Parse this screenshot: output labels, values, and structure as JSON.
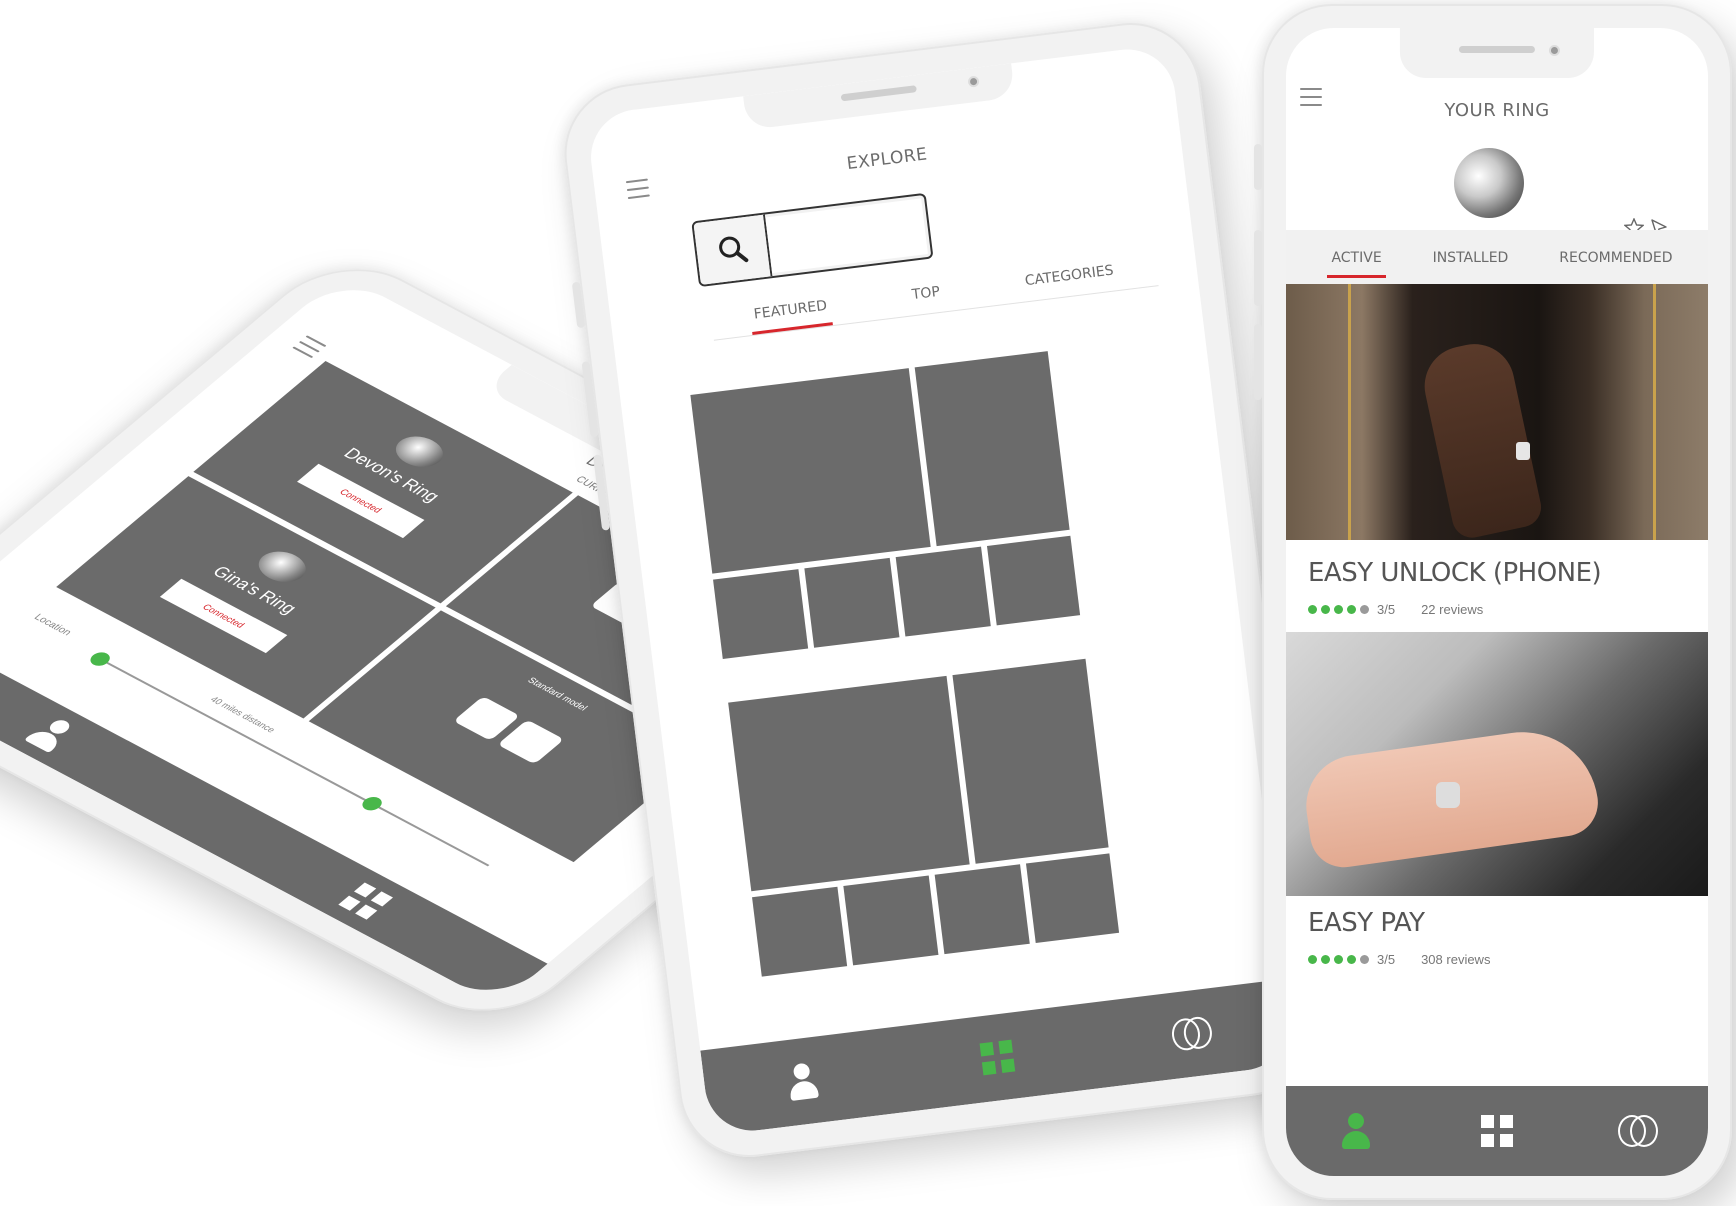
{
  "colors": {
    "accent_red": "#d7262c",
    "active_green": "#48b74a",
    "placeholder_gray": "#6b6b6b",
    "nav_gray": "#6a6a6a"
  },
  "devices_screen": {
    "title": "DEVICES",
    "section": "CURRENT",
    "devices": [
      {
        "name": "Devon's Ring",
        "status": "Connected",
        "model_label": "Standard model"
      },
      {
        "name": "Gina's Ring",
        "status": "Connected",
        "model_label": "Standard model"
      }
    ],
    "location_label": "Location",
    "distance_label": "40 miles distance"
  },
  "explore_screen": {
    "title": "EXPLORE",
    "tabs": [
      {
        "label": "FEATURED",
        "active": true
      },
      {
        "label": "TOP",
        "active": false
      },
      {
        "label": "CATEGORIES",
        "active": false
      }
    ],
    "search_icon": "search-icon",
    "nav": [
      {
        "icon": "person-icon",
        "active": false
      },
      {
        "icon": "grid-icon",
        "active": true
      },
      {
        "icon": "rings-icon",
        "active": false
      }
    ]
  },
  "ring_screen": {
    "title": "YOUR RING",
    "tabs": [
      {
        "label": "ACTIVE",
        "active": true
      },
      {
        "label": "INSTALLED",
        "active": false
      },
      {
        "label": "RECOMMENDED",
        "active": false
      }
    ],
    "apps": [
      {
        "title": "EASY UNLOCK (PHONE)",
        "rating": 4,
        "rating_max": 5,
        "score": "3/5",
        "reviews": "22 reviews"
      },
      {
        "title": "EASY PAY",
        "rating": 4,
        "rating_max": 5,
        "score": "3/5",
        "reviews": "308 reviews"
      }
    ],
    "nav": [
      {
        "icon": "person-icon",
        "active": true
      },
      {
        "icon": "grid-icon",
        "active": false
      },
      {
        "icon": "rings-icon",
        "active": false
      }
    ]
  }
}
